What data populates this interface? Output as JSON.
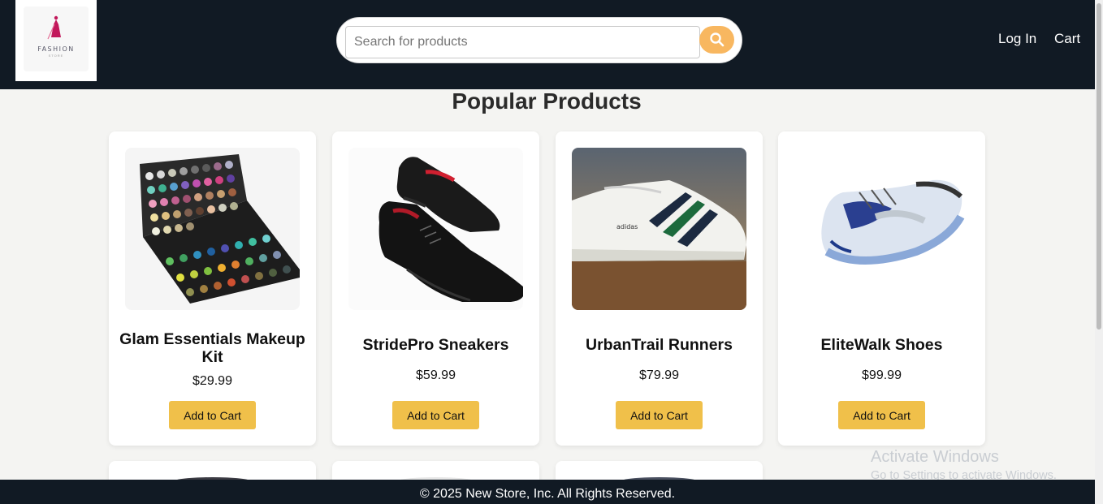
{
  "header": {
    "logo_text": "FASHION",
    "logo_subtext": "STORE",
    "search_placeholder": "Search for products",
    "login_label": "Log In",
    "cart_label": "Cart"
  },
  "main": {
    "title": "Popular Products",
    "products": [
      {
        "name": "Glam Essentials Makeup Kit",
        "price": "$29.99",
        "button": "Add to Cart"
      },
      {
        "name": "StridePro Sneakers",
        "price": "$59.99",
        "button": "Add to Cart"
      },
      {
        "name": "UrbanTrail Runners",
        "price": "$79.99",
        "button": "Add to Cart"
      },
      {
        "name": "EliteWalk Shoes",
        "price": "$99.99",
        "button": "Add to Cart"
      }
    ]
  },
  "watermark": {
    "line1": "Activate Windows",
    "line2": "Go to Settings to activate Windows."
  },
  "footer": {
    "text": "© 2025 New Store, Inc. All Rights Reserved."
  },
  "colors": {
    "header_bg": "#111a24",
    "search_button": "#f8b760",
    "add_button": "#f0c04a"
  }
}
